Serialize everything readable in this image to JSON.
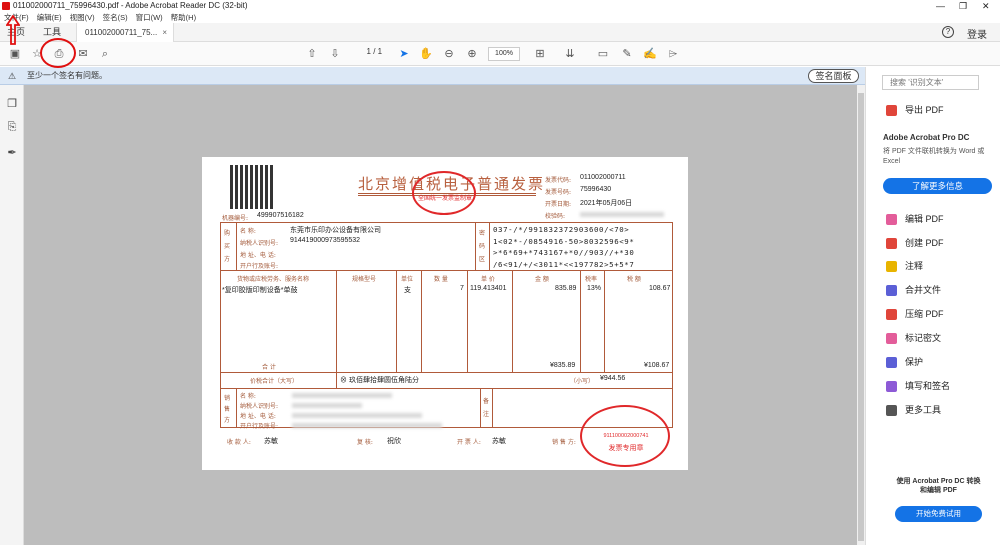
{
  "window": {
    "title": "011002000711_75996430.pdf - Adobe Acrobat Reader DC (32-bit)",
    "min": "—",
    "max": "❐",
    "close": "✕"
  },
  "menu": [
    "文件(F)",
    "编辑(E)",
    "视图(V)",
    "签名(S)",
    "窗口(W)",
    "帮助(H)"
  ],
  "tabs": {
    "home": "主页",
    "tools": "工具",
    "doc": "011002000711_75...",
    "doc_close": "×"
  },
  "header": {
    "help": "?",
    "login": "登录"
  },
  "toolbar": {
    "page_current": "1",
    "page_total": "/ 1",
    "zoom": "100%"
  },
  "notice": {
    "text": "至少一个签名有问题。",
    "sign_panel": "签名面板"
  },
  "right_panel": {
    "search_placeholder": "搜索 '识别文本'",
    "export_pdf": "导出 PDF",
    "pro_title": "Adobe Acrobat Pro DC",
    "pro_desc": "将 PDF 文件联机转换为 Word 或 Excel",
    "learn_more": "了解更多信息",
    "tools": [
      {
        "label": "编辑 PDF",
        "color": "#e35d9a"
      },
      {
        "label": "创建 PDF",
        "color": "#e0453a"
      },
      {
        "label": "注释",
        "color": "#e8b400"
      },
      {
        "label": "合并文件",
        "color": "#5b5fd6"
      },
      {
        "label": "压缩 PDF",
        "color": "#e0453a"
      },
      {
        "label": "标记密文",
        "color": "#e35d9a"
      },
      {
        "label": "保护",
        "color": "#5b5fd6"
      },
      {
        "label": "填写和签名",
        "color": "#8d5ad6"
      },
      {
        "label": "更多工具",
        "color": "#555555"
      }
    ],
    "trial_text": "使用 Acrobat Pro DC 转换和编辑 PDF",
    "trial_button": "开始免费试用"
  },
  "invoice": {
    "title": "北京增值税电子普通发票",
    "code_label": "发票代码:",
    "code": "011002000711",
    "number_label": "发票号码:",
    "number": "75996430",
    "date_label": "开票日期:",
    "date": "2021年05月06日",
    "check_label": "校验码:",
    "machine_label": "机器编号:",
    "machine_no": "499907516182",
    "buyer_section": "购买方",
    "name_label": "名 称:",
    "buyer_name": "东莞市乐印办公设备有限公司",
    "taxid_label": "纳税人识别号:",
    "buyer_taxid": "914419000973595532",
    "addr_label": "地 址、电 话:",
    "bank_label": "开户行及账号:",
    "cipher_label": "密码区",
    "cipher": [
      "037-/*/991832372903600/<70>",
      "1<02*-/0854916-50>8032596<9*",
      ">*6*69+*743167+*0//903//+*30",
      "/6<91/+/<3011*<<197782>5+5*7"
    ],
    "col_goods": "货物或应税劳务、服务名称",
    "col_spec": "规格型号",
    "col_unit": "单位",
    "col_qty": "数 量",
    "col_price": "单 价",
    "col_amount": "金 额",
    "col_rate": "税率",
    "col_tax": "税 额",
    "item_name": "*复印胶版印制设备*单鼓",
    "item_unit": "支",
    "item_qty": "7",
    "item_price": "119.413401",
    "item_amount": "835.89",
    "item_rate": "13%",
    "item_tax": "108.67",
    "total_label": "合 计",
    "total_amount": "¥835.89",
    "total_tax": "¥108.67",
    "sum_label": "价税合计（大写）",
    "sum_words": "玖佰肆拾肆圆伍角陆分",
    "sum_small_label": "（小写）",
    "sum_small": "¥944.56",
    "seller_section": "销售方",
    "remark_label": "备注",
    "payee_label": "收 款 人:",
    "payee": "苏敏",
    "reviewer_label": "复 核:",
    "reviewer": "祝欣",
    "issuer_label": "开 票 人:",
    "issuer": "苏敏",
    "seller_label": "销 售 方:",
    "stamp1_text": "全国统一发票监制章",
    "stamp2_code": "911100002000741",
    "stamp2_text": "发票专用章"
  }
}
